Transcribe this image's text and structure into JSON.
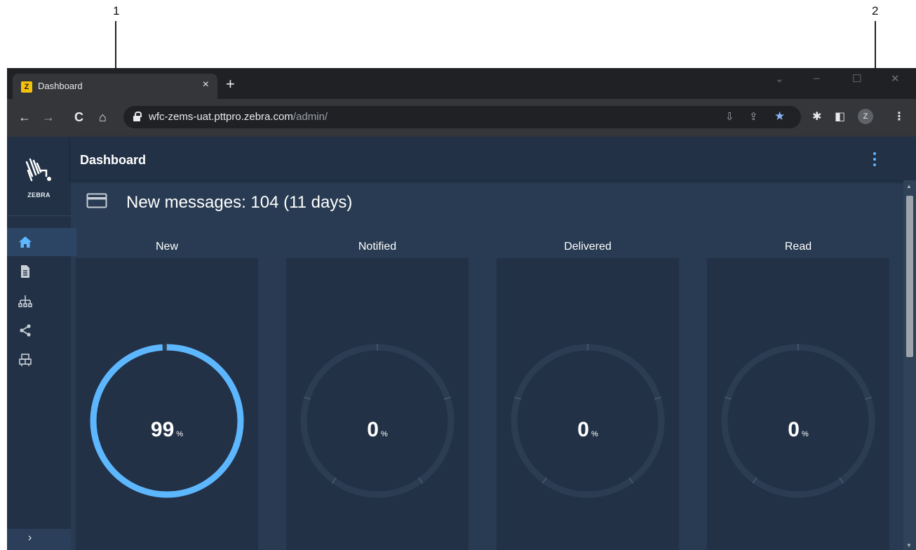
{
  "callouts": [
    "1",
    "2"
  ],
  "browser": {
    "tab_title": "Dashboard",
    "tab_close": "×",
    "new_tab": "+",
    "url_host": "wfc-zems-uat.pttpro.zebra.com",
    "url_path": "/admin/",
    "profile_initial": "Z",
    "window_controls": [
      "minimize-icon",
      "maximize-icon",
      "close-icon"
    ]
  },
  "app": {
    "logo_text": "ZEBRA",
    "page_title": "Dashboard",
    "sidebar_items": [
      "home-icon",
      "document-icon",
      "hierarchy-icon",
      "share-icon",
      "devices-icon"
    ],
    "expand_label": "›",
    "messages_summary": "New messages: 104 (11 days)",
    "columns": [
      {
        "label": "New",
        "value": "99",
        "unit": "%",
        "fraction": 0.99
      },
      {
        "label": "Notified",
        "value": "0",
        "unit": "%",
        "fraction": 0
      },
      {
        "label": "Delivered",
        "value": "0",
        "unit": "%",
        "fraction": 0
      },
      {
        "label": "Read",
        "value": "0",
        "unit": "%",
        "fraction": 0
      }
    ]
  },
  "colors": {
    "accent": "#5db7ff",
    "gauge_track": "#2c3d53",
    "panel": "#223146",
    "background": "#283b52"
  }
}
